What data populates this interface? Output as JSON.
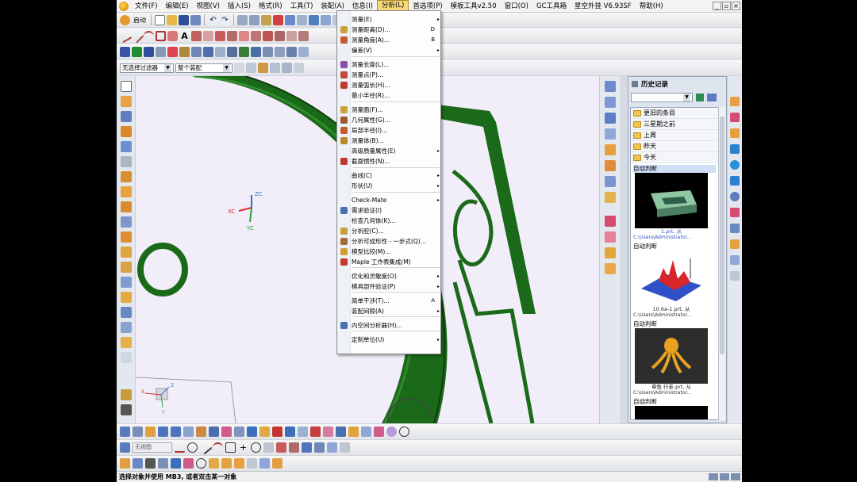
{
  "menubar": {
    "items": [
      "文件(F)",
      "编辑(E)",
      "视图(V)",
      "插入(S)",
      "格式(R)",
      "工具(T)",
      "装配(A)",
      "信息(I)",
      "分析(L)",
      "首选项(P)",
      "模板工具v2.50",
      "窗口(O)",
      "GC工具箱",
      "星空外挂 V6.93SF",
      "帮助(H)"
    ],
    "active_index": 8
  },
  "toolbar1": {
    "start_label": "启动"
  },
  "filterbar": {
    "type_filter": "无选择过滤器",
    "scope": "整个装配"
  },
  "dropdown": {
    "items": [
      {
        "label": "测量(E)",
        "shortcut": "",
        "sub": "▸"
      },
      {
        "label": "测量距离(D)...",
        "shortcut": "D",
        "sub": ""
      },
      {
        "label": "测量角度(A)...",
        "shortcut": "B",
        "sub": ""
      },
      {
        "label": "偏差(V)",
        "shortcut": "",
        "sub": "▸"
      },
      {
        "label": "测量长度(L)...",
        "shortcut": "",
        "sub": ""
      },
      {
        "label": "测量点(P)...",
        "shortcut": "",
        "sub": ""
      },
      {
        "label": "测量弧长(H)...",
        "shortcut": "",
        "sub": ""
      },
      {
        "label": "最小半径(R)...",
        "shortcut": "",
        "sub": ""
      },
      {
        "label": "测量面(F)...",
        "shortcut": "",
        "sub": ""
      },
      {
        "label": "几何属性(G)...",
        "shortcut": "",
        "sub": ""
      },
      {
        "label": "局部半径(I)...",
        "shortcut": "",
        "sub": ""
      },
      {
        "label": "测量体(B)...",
        "shortcut": "",
        "sub": ""
      },
      {
        "label": "高级质量属性(E)",
        "shortcut": "",
        "sub": "▸"
      },
      {
        "label": "截面惯性(N)...",
        "shortcut": "",
        "sub": ""
      },
      {
        "label": "曲线(C)",
        "shortcut": "",
        "sub": "▸"
      },
      {
        "label": "形状(U)",
        "shortcut": "",
        "sub": "▸"
      },
      {
        "label": "Check-Mate",
        "shortcut": "",
        "sub": "▸"
      },
      {
        "label": "需求验证(I)",
        "shortcut": "",
        "sub": ""
      },
      {
        "label": "检查几何体(K)...",
        "shortcut": "",
        "sub": ""
      },
      {
        "label": "分析腔(C)...",
        "shortcut": "",
        "sub": ""
      },
      {
        "label": "分析可成形性 - 一步式(Q)...",
        "shortcut": "",
        "sub": ""
      },
      {
        "label": "模型比较(M)...",
        "shortcut": "",
        "sub": ""
      },
      {
        "label": "Maple 工作表集成(M)",
        "shortcut": "",
        "sub": ""
      },
      {
        "label": "优化和灵敏度(O)",
        "shortcut": "",
        "sub": "▸"
      },
      {
        "label": "模具部件验证(P)",
        "shortcut": "",
        "sub": "▸"
      },
      {
        "label": "简单干涉(T)...",
        "shortcut": "A",
        "sub": ""
      },
      {
        "label": "装配间隙(A)",
        "shortcut": "",
        "sub": "▸"
      },
      {
        "label": "内空间分析器(H)...",
        "shortcut": "",
        "sub": ""
      },
      {
        "label": "定制单位(U)",
        "shortcut": "",
        "sub": "▸"
      }
    ]
  },
  "history": {
    "title": "历史记录",
    "folders": [
      "更旧的条目",
      "三星期之前",
      "上周",
      "昨天",
      "今天"
    ],
    "entries": [
      {
        "label": "自动判断",
        "caption": "1.prt, 从",
        "path": "C:\\Users\\Administrator..."
      },
      {
        "label": "自动判断",
        "caption": "10.6a-1.prt, 从",
        "path": "C:\\Users\\Administrator..."
      },
      {
        "label": "自动判断",
        "caption": "章鱼 行走.prt, 从",
        "path": "C:\\Users\\Administrator..."
      },
      {
        "label": "自动判断",
        "caption": "",
        "path": ""
      }
    ]
  },
  "triad": {
    "zc": "ZC",
    "xc": "XC",
    "yc": "YC"
  },
  "small_triad": {
    "x": "X",
    "z": "Z",
    "y": "Y"
  },
  "bottom_toolbar": {
    "mode_label": "无视图"
  },
  "status": {
    "text": "选择对象并使用 MB3, 或者双击某一对象"
  },
  "colors": {
    "model_green": "#1b6a1a",
    "canvas_bg": "#f2eef9",
    "menu_highlight": "#f5d97a"
  }
}
